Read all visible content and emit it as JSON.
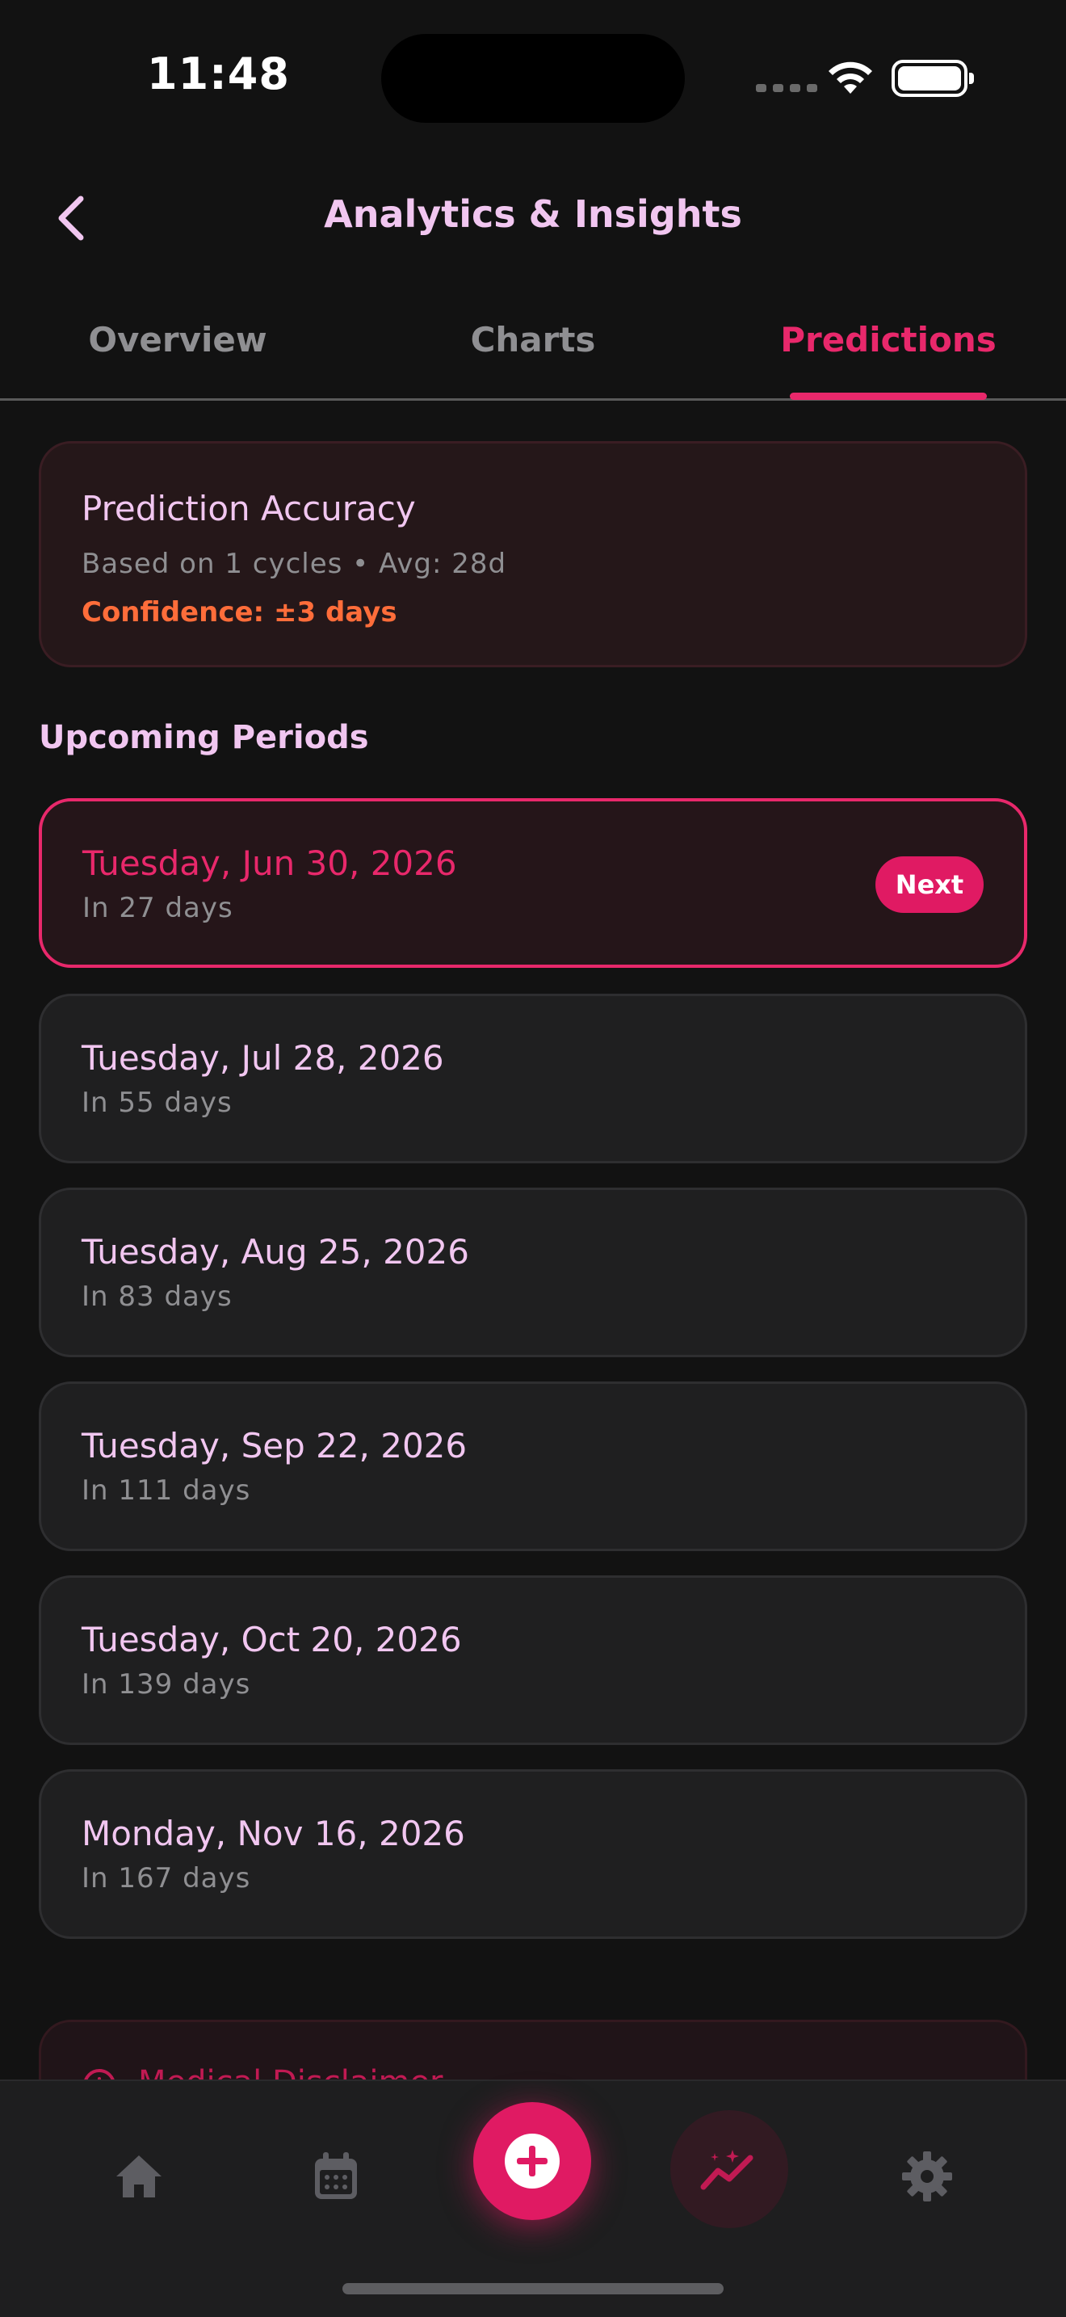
{
  "status_bar": {
    "time": "11:48"
  },
  "header": {
    "title": "Analytics & Insights"
  },
  "tabs": [
    {
      "label": "Overview",
      "active": false
    },
    {
      "label": "Charts",
      "active": false
    },
    {
      "label": "Predictions",
      "active": true
    }
  ],
  "accuracy": {
    "title": "Prediction Accuracy",
    "subtitle": "Based on 1 cycles • Avg: 28d",
    "confidence": "Confidence: ±3 days"
  },
  "upcoming": {
    "section_title": "Upcoming Periods",
    "next_badge": "Next",
    "items": [
      {
        "date": "Tuesday, Jun 30, 2026",
        "days": "In 27 days"
      },
      {
        "date": "Tuesday, Jul 28, 2026",
        "days": "In 55 days"
      },
      {
        "date": "Tuesday, Aug 25, 2026",
        "days": "In 83 days"
      },
      {
        "date": "Tuesday, Sep 22, 2026",
        "days": "In 111 days"
      },
      {
        "date": "Tuesday, Oct 20, 2026",
        "days": "In 139 days"
      },
      {
        "date": "Monday, Nov 16, 2026",
        "days": "In 167 days"
      }
    ]
  },
  "disclaimer": {
    "title": "Medical Disclaimer"
  },
  "bottom_nav": {
    "items": [
      "home-icon",
      "calendar-icon",
      "add-icon",
      "analytics-icon",
      "settings-icon"
    ],
    "active": "analytics-icon"
  },
  "colors": {
    "accent": "#e8286b",
    "confidence": "#ff6d3a",
    "title_text": "#f1c6f0",
    "muted_text": "#8f8f92",
    "background": "#121212"
  }
}
